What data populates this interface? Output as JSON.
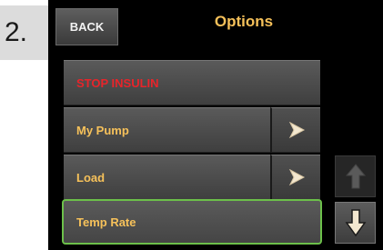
{
  "step_number": "2.",
  "header": {
    "back_label": "BACK",
    "title": "Options"
  },
  "menu": {
    "items": [
      {
        "label": "STOP INSULIN",
        "color": "#e8242a"
      },
      {
        "label": "My Pump",
        "icon": "chevron-right-icon"
      },
      {
        "label": "Load",
        "icon": "chevron-right-icon"
      },
      {
        "label": "Temp Rate",
        "selected": true
      }
    ]
  },
  "scroll": {
    "up_icon": "arrow-up-icon",
    "down_icon": "arrow-down-icon"
  },
  "colors": {
    "accent": "#f6c15a",
    "warning": "#e8242a",
    "selection": "#6cc04a"
  }
}
